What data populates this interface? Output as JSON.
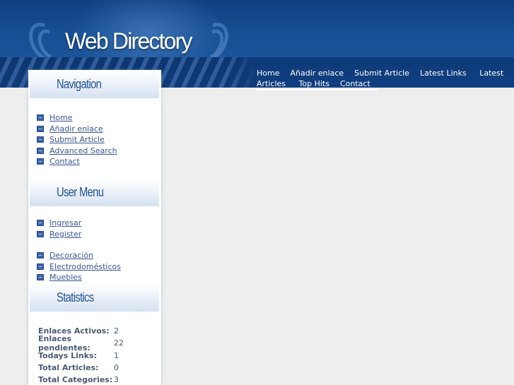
{
  "header": {
    "logo_text": "Web Directory"
  },
  "topnav": {
    "items": [
      {
        "label": "Home"
      },
      {
        "label": "Añadir enlace"
      },
      {
        "label": "Submit Article"
      },
      {
        "label": "Latest Links"
      },
      {
        "label": "Latest Articles"
      },
      {
        "label": "Top Hits"
      },
      {
        "label": "Contact"
      }
    ]
  },
  "sidebar": {
    "navigation": {
      "title": "Navigation",
      "items": [
        {
          "label": "Home"
        },
        {
          "label": "Añadir enlace"
        },
        {
          "label": "Submit Article"
        },
        {
          "label": "Advanced Search"
        },
        {
          "label": "Contact"
        }
      ]
    },
    "user_menu": {
      "title": "User Menu",
      "items": [
        {
          "label": "Ingresar"
        },
        {
          "label": "Register"
        }
      ],
      "categories": [
        {
          "label": "Decoración"
        },
        {
          "label": "Electrodomésticos"
        },
        {
          "label": "Muebles"
        }
      ]
    },
    "statistics": {
      "title": "Statistics",
      "rows": [
        {
          "label": "Enlaces Activos:",
          "value": "2"
        },
        {
          "label": "Enlaces pendientes:",
          "value": "22"
        },
        {
          "label": "Todays Links:",
          "value": "1"
        },
        {
          "label": "Total Articles:",
          "value": "0"
        },
        {
          "label": "Total Categories:",
          "value": "3"
        }
      ]
    }
  }
}
